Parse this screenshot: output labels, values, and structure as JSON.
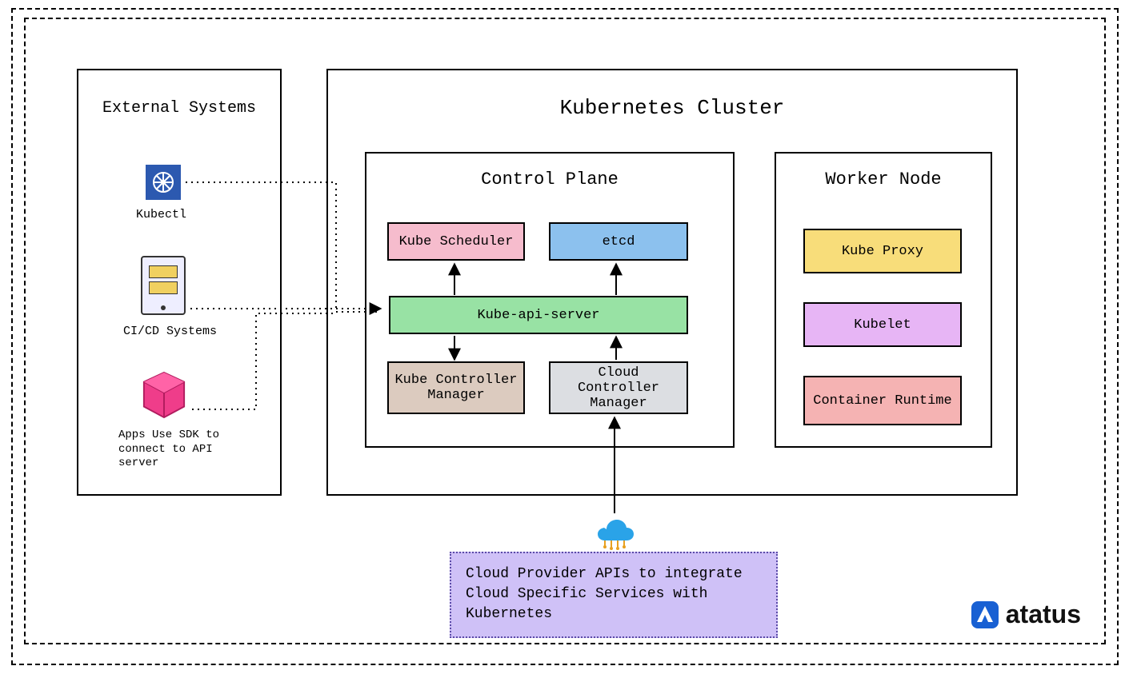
{
  "external": {
    "title": "External Systems",
    "kubectl_label": "Kubectl",
    "cicd_label": "CI/CD Systems",
    "sdk_label": "Apps Use SDK to connect to API server"
  },
  "cluster": {
    "title": "Kubernetes Cluster",
    "control_plane": {
      "title": "Control Plane",
      "scheduler": "Kube Scheduler",
      "etcd": "etcd",
      "api": "Kube-api-server",
      "kcm": "Kube Controller Manager",
      "ccm": "Cloud Controller Manager"
    },
    "worker": {
      "title": "Worker Node",
      "kube_proxy": "Kube Proxy",
      "kubelet": "Kubelet",
      "container_runtime": "Container Runtime"
    }
  },
  "cloud_apis": "Cloud Provider APIs to integrate Cloud Specific Services with Kubernetes",
  "brand": "atatus",
  "colors": {
    "scheduler_bg": "#f6bccd",
    "etcd_bg": "#8cc1ee",
    "api_bg": "#98e2a4",
    "kcm_bg": "#dccbbf",
    "ccm_bg": "#dcdee2",
    "kube_proxy_bg": "#f8dd7a",
    "kubelet_bg": "#e7b5f5",
    "crt_bg": "#f5b3b3",
    "cloud_apis_bg": "#cfc1f7",
    "kubectl_icon_bg": "#2c59b0",
    "sdk_icon": "#ef3d8a",
    "cloud_icon": "#2aa3e8"
  },
  "icons": {
    "kubectl": "kubernetes-wheel-icon",
    "cicd": "tablet-device-icon",
    "sdk": "cube-icon",
    "cloud": "cloud-network-icon",
    "brand": "atatus-logo-icon"
  }
}
